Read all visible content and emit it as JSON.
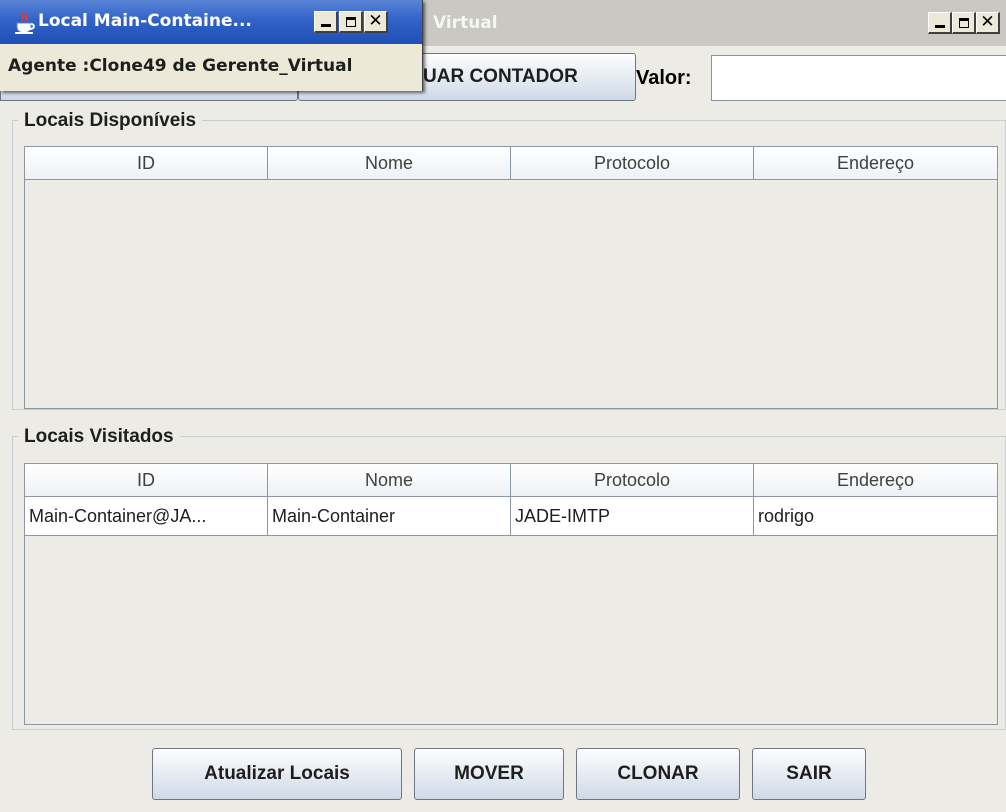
{
  "back_window": {
    "title": "Virtual",
    "toolbar": {
      "contador_button": "UAR CONTADOR",
      "valor_label": "Valor:",
      "valor_value": ""
    },
    "disponiveis": {
      "title": "Locais Disponíveis",
      "columns": [
        "ID",
        "Nome",
        "Protocolo",
        "Endereço"
      ],
      "rows": []
    },
    "visitados": {
      "title": "Locais Visitados",
      "columns": [
        "ID",
        "Nome",
        "Protocolo",
        "Endereço"
      ],
      "rows": [
        [
          "Main-Container@JA...",
          "Main-Container",
          "JADE-IMTP",
          "rodrigo"
        ]
      ]
    },
    "buttons": {
      "atualizar": "Atualizar Locais",
      "mover": "MOVER",
      "clonar": "CLONAR",
      "sair": "SAIR"
    }
  },
  "front_window": {
    "title": "Local Main-Containe...",
    "message": "Agente :Clone49 de Gerente_Virtual"
  },
  "icons": {
    "app": "java-coffee-icon",
    "minimize": "minimize-icon",
    "maximize": "maximize-icon",
    "close": "close-icon"
  },
  "colors": {
    "titlebar_active": "#3163c8",
    "titlebar_inactive": "#c9c8c2",
    "window_bg": "#ecebe6"
  }
}
